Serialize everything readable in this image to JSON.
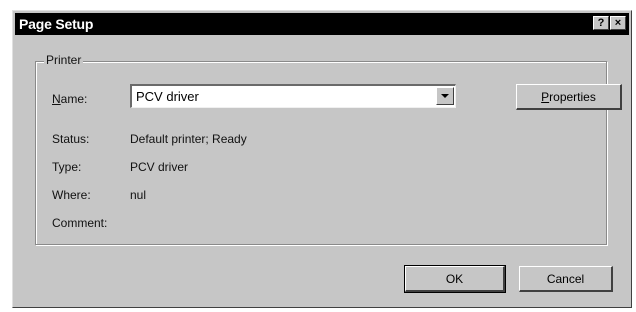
{
  "window": {
    "title": "Page Setup",
    "help_button": "?",
    "close_button": "×"
  },
  "printer_group": {
    "label": "Printer",
    "name_label_u": "N",
    "name_label_rest": "ame:",
    "name_value": "PCV driver",
    "properties_u": "P",
    "properties_rest": "roperties",
    "status_label": "Status:",
    "status_value": "Default printer; Ready",
    "type_label": "Type:",
    "type_value": "PCV driver",
    "where_label": "Where:",
    "where_value": "nul",
    "comment_label": "Comment:"
  },
  "buttons": {
    "ok": "OK",
    "cancel": "Cancel"
  }
}
